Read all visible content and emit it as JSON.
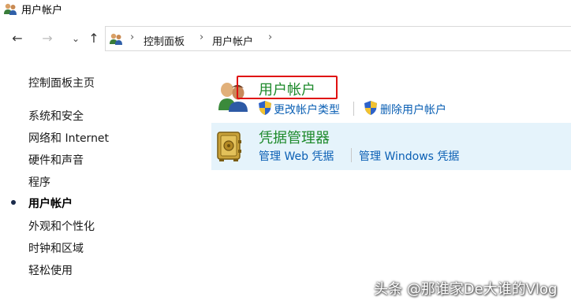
{
  "window": {
    "title": "用户帐户"
  },
  "nav": {
    "back_icon": "arrow-left-icon",
    "forward_icon": "arrow-right-icon",
    "recent_icon": "chevron-down-icon",
    "up_icon": "arrow-up-icon",
    "breadcrumb": [
      "控制面板",
      "用户帐户"
    ]
  },
  "sidebar": {
    "home": "控制面板主页",
    "items": [
      {
        "label": "系统和安全",
        "current": false
      },
      {
        "label": "网络和 Internet",
        "current": false
      },
      {
        "label": "硬件和声音",
        "current": false
      },
      {
        "label": "程序",
        "current": false
      },
      {
        "label": "用户帐户",
        "current": true
      },
      {
        "label": "外观和个性化",
        "current": false
      },
      {
        "label": "时钟和区域",
        "current": false
      },
      {
        "label": "轻松使用",
        "current": false
      }
    ]
  },
  "main": {
    "user_accounts": {
      "title": "用户帐户",
      "links": [
        "更改帐户类型",
        "删除用户帐户"
      ]
    },
    "credential_manager": {
      "title": "凭据管理器",
      "links": [
        "管理 Web 凭据",
        "管理 Windows 凭据"
      ]
    }
  },
  "colors": {
    "section_title": "#1e8a2c",
    "link": "#0a5fb4",
    "highlight": "#e01010",
    "selected_bg": "#e5f3fb"
  },
  "watermark": "头条 @那谁家De大谁的Vlog"
}
